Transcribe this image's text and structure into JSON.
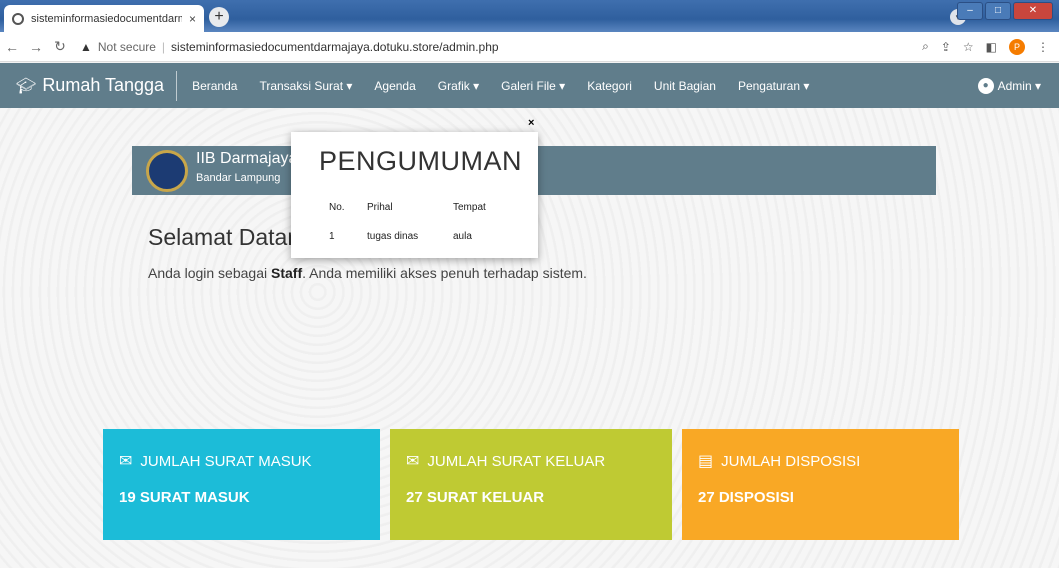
{
  "browser": {
    "tab_title": "sisteminformasiedocumentdarma",
    "tab_close": "×",
    "new_tab": "+",
    "not_secure": "Not secure",
    "url": "sisteminformasiedocumentdarmajaya.dotuku.store/admin.php",
    "profile_initial": "P"
  },
  "navbar": {
    "brand": "Rumah Tangga",
    "menu": [
      {
        "label": "Beranda"
      },
      {
        "label": "Transaksi Surat ▾"
      },
      {
        "label": "Agenda"
      },
      {
        "label": "Grafik ▾"
      },
      {
        "label": "Galeri File ▾"
      },
      {
        "label": "Kategori"
      },
      {
        "label": "Unit Bagian"
      },
      {
        "label": "Pengaturan ▾"
      }
    ],
    "user": "Admin ▾"
  },
  "header": {
    "institution": "IIB Darmajaya",
    "city": "Bandar Lampung"
  },
  "main": {
    "welcome": "Selamat Datang",
    "login_prefix": "Anda login sebagai ",
    "role": "Staff",
    "login_suffix": ". Anda memiliki akses penuh terhadap sistem."
  },
  "cards": [
    {
      "title": "JUMLAH SURAT MASUK",
      "count": "19 SURAT MASUK",
      "icon": "envelope-icon",
      "color": "#1cbcd8"
    },
    {
      "title": "JUMLAH SURAT KELUAR",
      "count": "27 SURAT KELUAR",
      "icon": "envelope-open-icon",
      "color": "#bfca33"
    },
    {
      "title": "JUMLAH DISPOSISI",
      "count": "27 DISPOSISI",
      "icon": "file-icon",
      "color": "#f9a825"
    }
  ],
  "popup": {
    "title": "PENGUMUMAN",
    "close": "×",
    "columns": [
      "No.",
      "Prihal",
      "Tempat"
    ],
    "rows": [
      {
        "no": "1",
        "prihal": "tugas dinas",
        "tempat": "aula"
      }
    ]
  }
}
